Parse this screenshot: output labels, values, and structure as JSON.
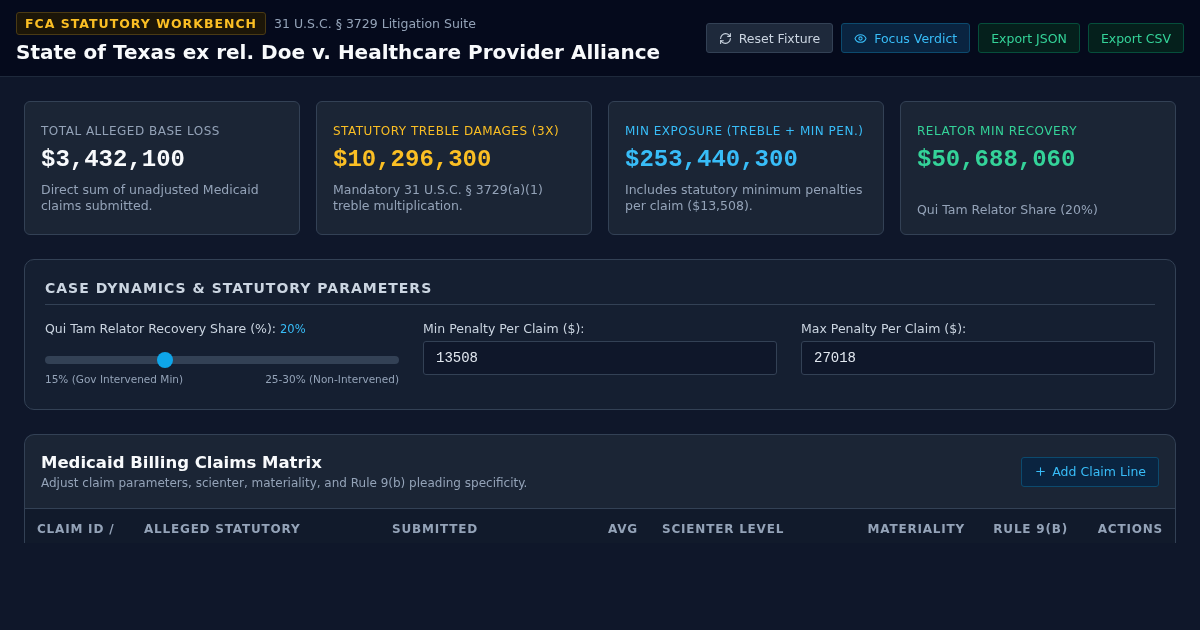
{
  "header": {
    "badge": "FCA STATUTORY WORKBENCH",
    "subtitle": "31 U.S.C. § 3729 Litigation Suite",
    "title": "State of Texas ex rel. Doe v. Healthcare Provider Alliance",
    "buttons": [
      {
        "label": "Reset Fixture",
        "kind": "neutral"
      },
      {
        "label": "Focus Verdict",
        "kind": "info"
      },
      {
        "label": "Export JSON",
        "kind": "success"
      },
      {
        "label": "Export CSV",
        "kind": "success"
      }
    ]
  },
  "metrics": [
    {
      "label": "TOTAL ALLEGED BASE LOSS",
      "value": "$3,432,100",
      "note": "Direct sum of unadjusted Medicaid claims submitted.",
      "color": "#f8fafc"
    },
    {
      "label": "STATUTORY TREBLE DAMAGES (3X)",
      "value": "$10,296,300",
      "note": "Mandatory 31 U.S.C. § 3729(a)(1) treble multiplication.",
      "color": "#fbbf24"
    },
    {
      "label": "MIN EXPOSURE (TREBLE + MIN PEN.)",
      "value": "$253,440,300",
      "note": "Includes statutory minimum penalties per claim ($13,508).",
      "color": "#38bdf8"
    },
    {
      "label": "RELATOR MIN RECOVERY",
      "value": "$50,688,060",
      "note": "Qui Tam Relator Share (20%)",
      "color": "#34d399"
    }
  ],
  "parameters": {
    "title": "CASE DYNAMICS & STATUTORY PARAMETERS",
    "slider": {
      "label": "Qui Tam Relator Recovery Share (%):",
      "reading": "20%",
      "level": 0.34,
      "min_label": "15% (Gov Intervened Min)",
      "max_label": "25-30% (Non-Intervened)"
    },
    "fields": [
      {
        "label": "Min Penalty Per Claim ($):",
        "value": "13508"
      },
      {
        "label": "Max Penalty Per Claim ($):",
        "value": "27018"
      }
    ]
  },
  "claims": {
    "title": "Medicaid Billing Claims Matrix",
    "subtitle": "Adjust claim parameters, scienter, materiality, and Rule 9(b) pleading specificity.",
    "add_button": "Add Claim Line",
    "columns": [
      "CLAIM ID /",
      "ALLEGED STATUTORY",
      "SUBMITTED",
      "AVG",
      "SCIENTER LEVEL",
      "MATERIALITY",
      "RULE 9(B)",
      "ACTIONS"
    ]
  }
}
